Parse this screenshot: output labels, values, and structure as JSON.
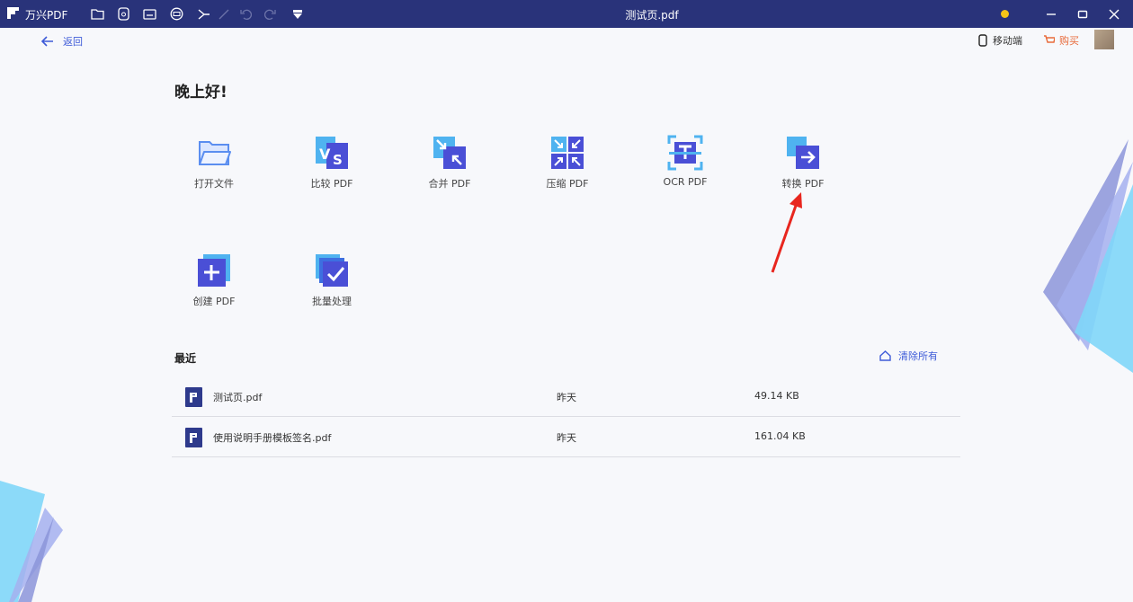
{
  "app": {
    "name": "万兴PDF",
    "document_title": "测试页.pdf"
  },
  "toolbar_icons": [
    "folder-icon",
    "print-preview-icon",
    "window-icon",
    "print-icon",
    "share-icon",
    "pen-icon",
    "undo-icon",
    "redo-icon",
    "dropdown-icon"
  ],
  "header": {
    "back_label": "返回",
    "mobile_label": "移动端",
    "buy_label": "购买"
  },
  "greeting": "晚上好!",
  "tools": [
    {
      "label": "打开文件",
      "icon": "folder-open-icon"
    },
    {
      "label": "比较 PDF",
      "icon": "compare-vs-icon"
    },
    {
      "label": "合并 PDF",
      "icon": "merge-icon"
    },
    {
      "label": "压缩 PDF",
      "icon": "compress-icon"
    },
    {
      "label": "OCR PDF",
      "icon": "ocr-scan-icon"
    },
    {
      "label": "转换 PDF",
      "icon": "convert-arrow-icon"
    },
    {
      "label": "创建 PDF",
      "icon": "create-plus-icon"
    },
    {
      "label": "批量处理",
      "icon": "batch-check-icon"
    }
  ],
  "recent": {
    "title": "最近",
    "clear_label": "清除所有",
    "files": [
      {
        "name": "测试页.pdf",
        "date": "昨天",
        "size": "49.14 KB"
      },
      {
        "name": "使用说明手册模板签名.pdf",
        "date": "昨天",
        "size": "161.04 KB"
      }
    ]
  },
  "colors": {
    "titlebar": "#29337a",
    "accent": "#3e5bd8",
    "arrow": "#e8261e"
  }
}
